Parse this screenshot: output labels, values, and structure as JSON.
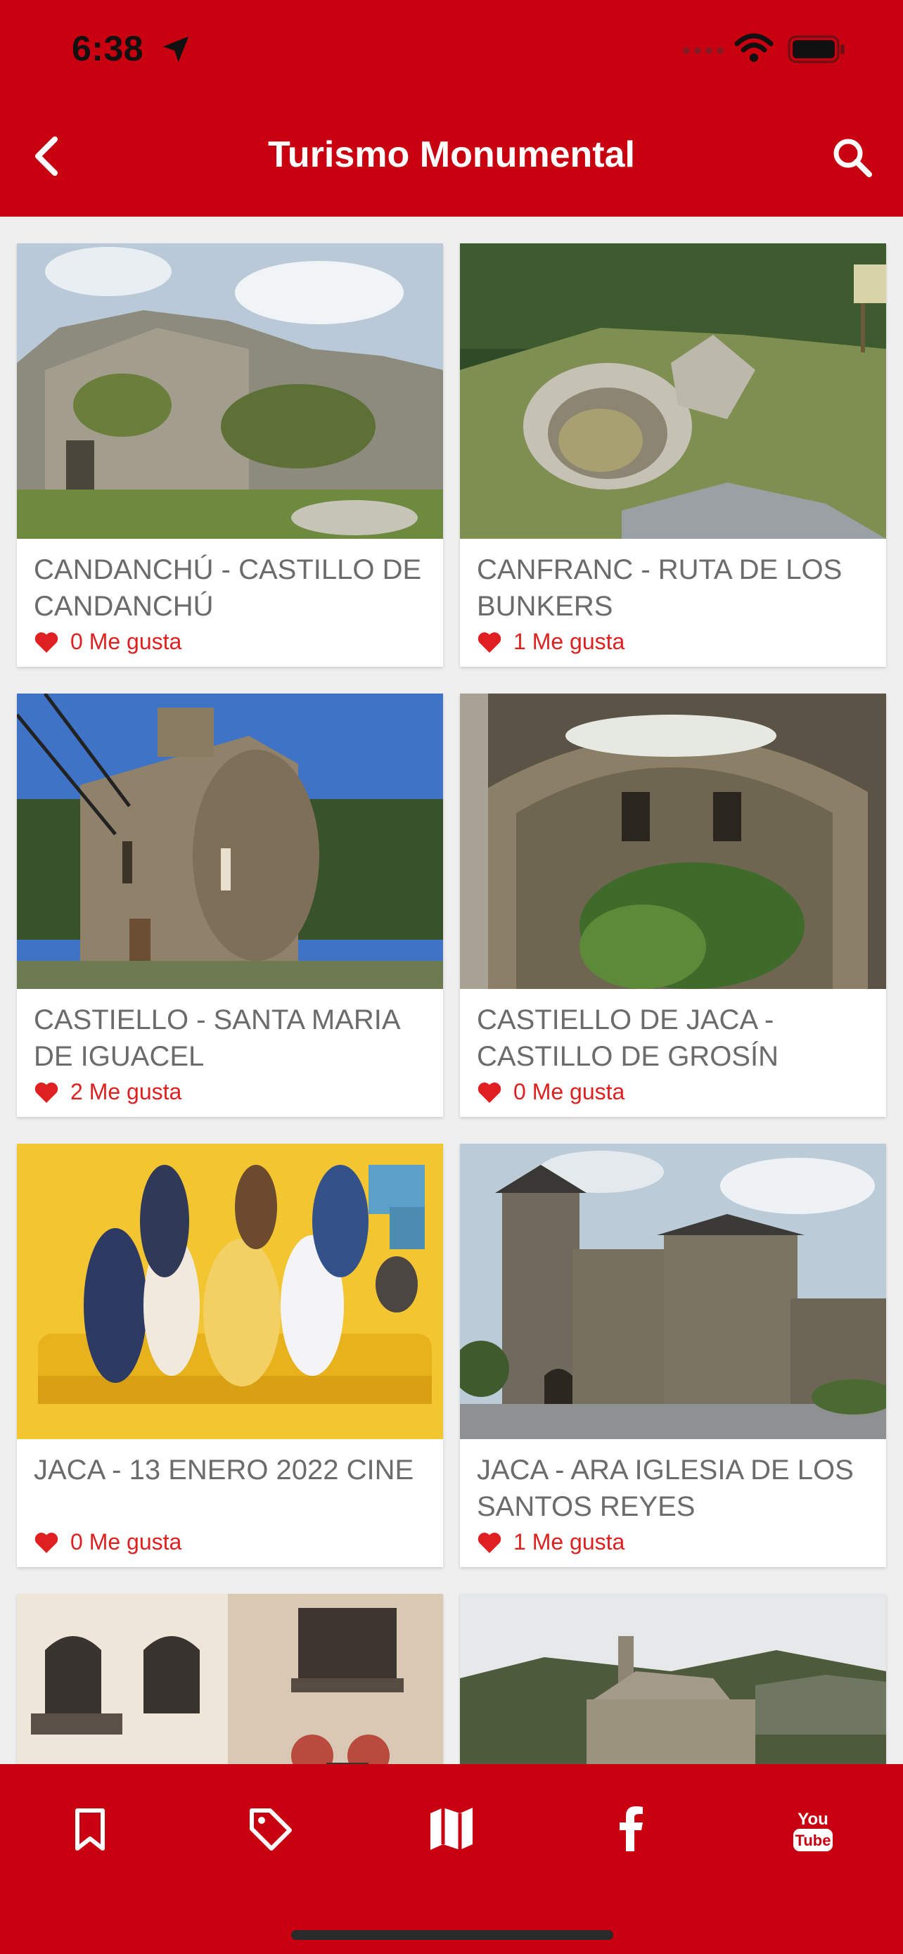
{
  "status": {
    "time": "6:38"
  },
  "header": {
    "title": "Turismo Monumental"
  },
  "cards": [
    {
      "title": "CANDANCHÚ - CASTILLO DE CANDANCHÚ",
      "likes": "0 Me gusta"
    },
    {
      "title": "CANFRANC - RUTA DE LOS BUNKERS",
      "likes": "1 Me gusta"
    },
    {
      "title": "CASTIELLO - SANTA MARIA DE IGUACEL",
      "likes": "2 Me gusta"
    },
    {
      "title": "CASTIELLO DE JACA - CASTILLO DE GROSÍN",
      "likes": "0 Me gusta"
    },
    {
      "title": "JACA - 13 ENERO 2022 CINE",
      "likes": "0 Me gusta"
    },
    {
      "title": "JACA - ARA IGLESIA DE LOS SANTOS REYES",
      "likes": "1 Me gusta"
    }
  ],
  "tabs": [
    {
      "icon": "bookmark-icon"
    },
    {
      "icon": "tag-icon"
    },
    {
      "icon": "map-icon"
    },
    {
      "icon": "facebook-icon"
    },
    {
      "icon": "youtube-icon"
    }
  ],
  "colors": {
    "brand": "#c8000f",
    "like": "#e02020",
    "card_text": "#6b6b6b"
  }
}
